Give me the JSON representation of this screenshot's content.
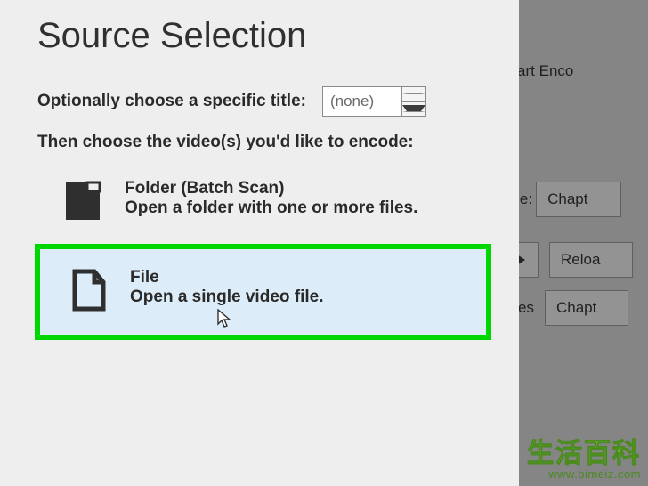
{
  "panel": {
    "title": "Source Selection",
    "title_label": "Optionally choose a specific title:",
    "spin_value": "(none)",
    "choose_label": "Then choose the video(s) you'd like to encode:",
    "options": {
      "folder": {
        "title": "Folder (Batch Scan)",
        "desc": "Open a folder with one or more files."
      },
      "file": {
        "title": "File",
        "desc": "Open a single video file."
      }
    }
  },
  "bg": {
    "start": "Start Enco",
    "nge": "nge:",
    "chapte1": "Chapt",
    "reload": "Reloa",
    "titles": "titles",
    "chapte2": "Chapt"
  },
  "watermark": {
    "cn": "生活百科",
    "url": "www.bimeiz.com"
  }
}
